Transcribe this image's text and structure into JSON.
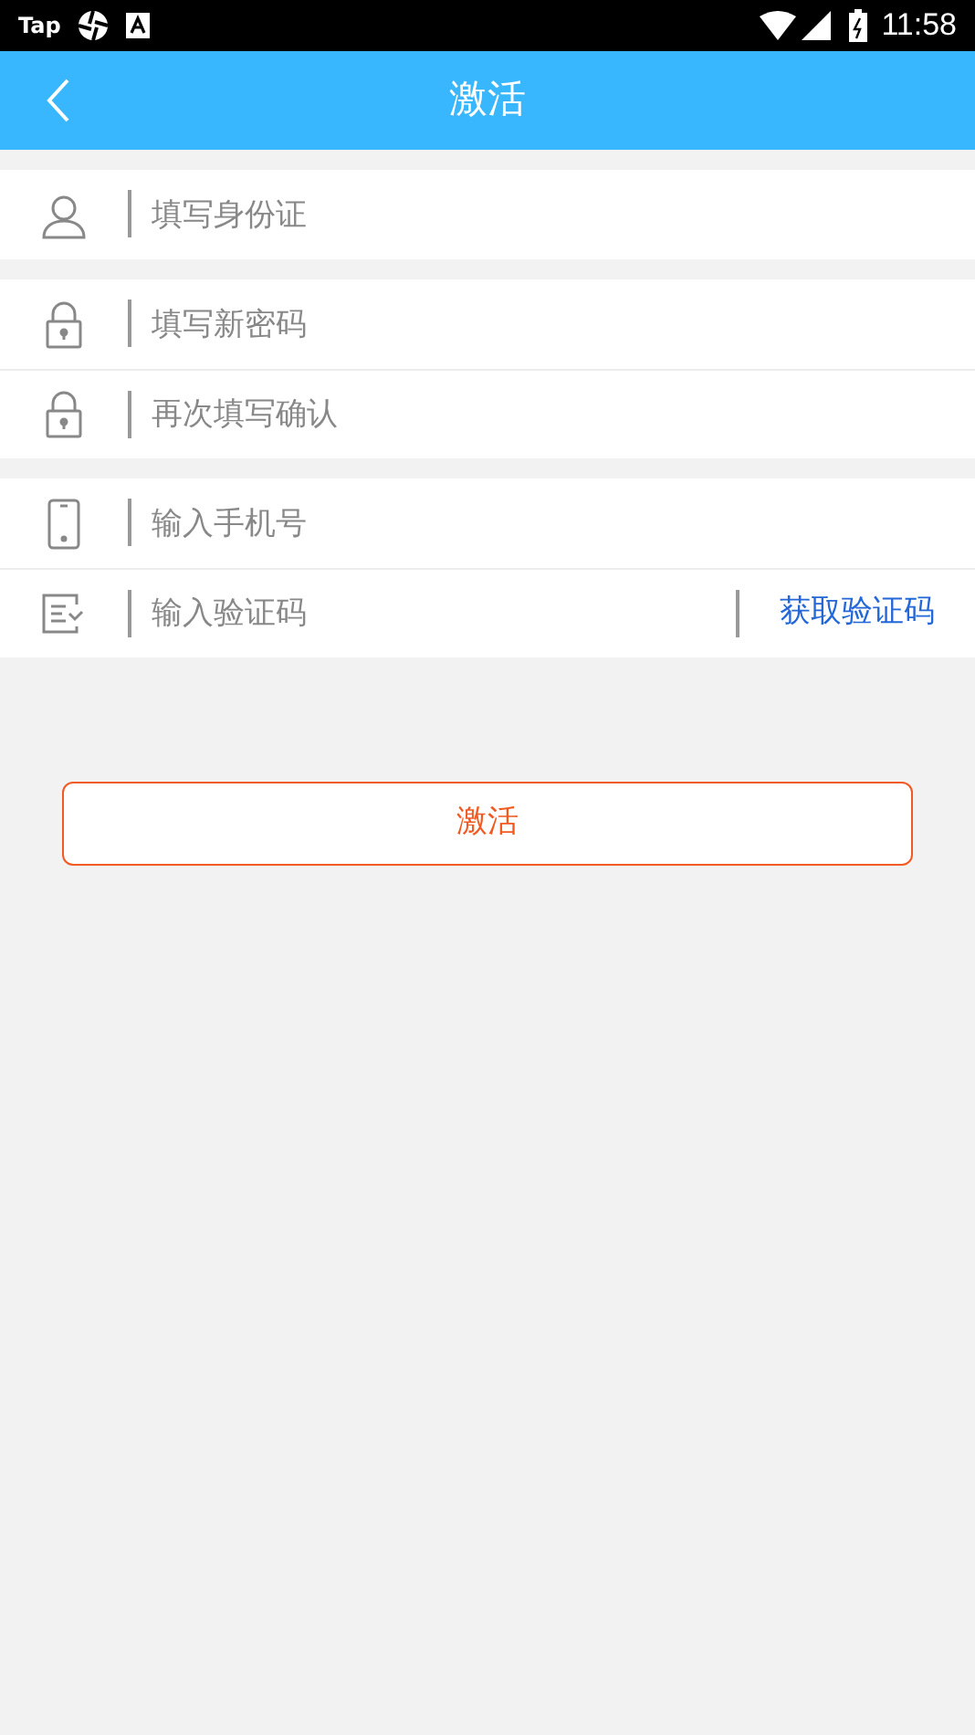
{
  "status_bar": {
    "app_label": "Tap",
    "time": "11:58"
  },
  "header": {
    "title": "激活"
  },
  "groups": [
    {
      "fields": [
        {
          "kind": "person",
          "placeholder": "填写身份证"
        }
      ]
    },
    {
      "fields": [
        {
          "kind": "lock",
          "placeholder": "填写新密码"
        },
        {
          "kind": "lock",
          "placeholder": "再次填写确认"
        }
      ]
    },
    {
      "fields": [
        {
          "kind": "phone",
          "placeholder": "输入手机号"
        },
        {
          "kind": "code",
          "placeholder": "输入验证码",
          "action": "获取验证码"
        }
      ]
    }
  ],
  "submit": "激活"
}
